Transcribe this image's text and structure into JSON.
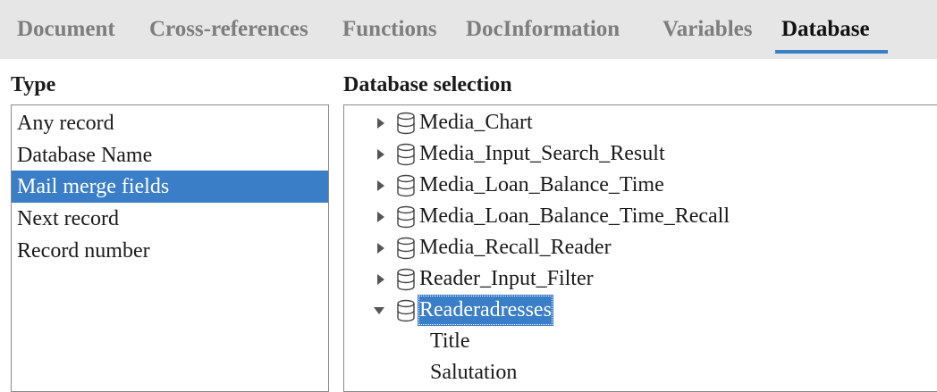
{
  "tabs": [
    {
      "label": "Document"
    },
    {
      "label": "Cross-references"
    },
    {
      "label": "Functions"
    },
    {
      "label": "DocInformation"
    },
    {
      "label": "Variables"
    },
    {
      "label": "Database",
      "active": true
    }
  ],
  "type_section": {
    "heading": "Type",
    "items": [
      {
        "label": "Any record"
      },
      {
        "label": "Database Name"
      },
      {
        "label": "Mail merge fields",
        "selected": true
      },
      {
        "label": "Next record"
      },
      {
        "label": "Record number"
      }
    ]
  },
  "database_section": {
    "heading": "Database selection",
    "tree": [
      {
        "label": "Media_Chart",
        "expanded": false,
        "icon": "database-table-icon"
      },
      {
        "label": "Media_Input_Search_Result",
        "expanded": false,
        "icon": "database-table-icon"
      },
      {
        "label": "Media_Loan_Balance_Time",
        "expanded": false,
        "icon": "database-table-icon"
      },
      {
        "label": "Media_Loan_Balance_Time_Recall",
        "expanded": false,
        "icon": "database-table-icon"
      },
      {
        "label": "Media_Recall_Reader",
        "expanded": false,
        "icon": "database-table-icon"
      },
      {
        "label": "Reader_Input_Filter",
        "expanded": false,
        "icon": "database-table-icon"
      },
      {
        "label": "Readeradresses",
        "expanded": true,
        "selected": true,
        "icon": "database-table-icon",
        "children": [
          {
            "label": "Title"
          },
          {
            "label": "Salutation"
          }
        ]
      }
    ]
  },
  "colors": {
    "accent": "#3b7ec8",
    "tabbar_bg": "#e6e6e6",
    "inactive_tab": "#7d7d7d"
  }
}
